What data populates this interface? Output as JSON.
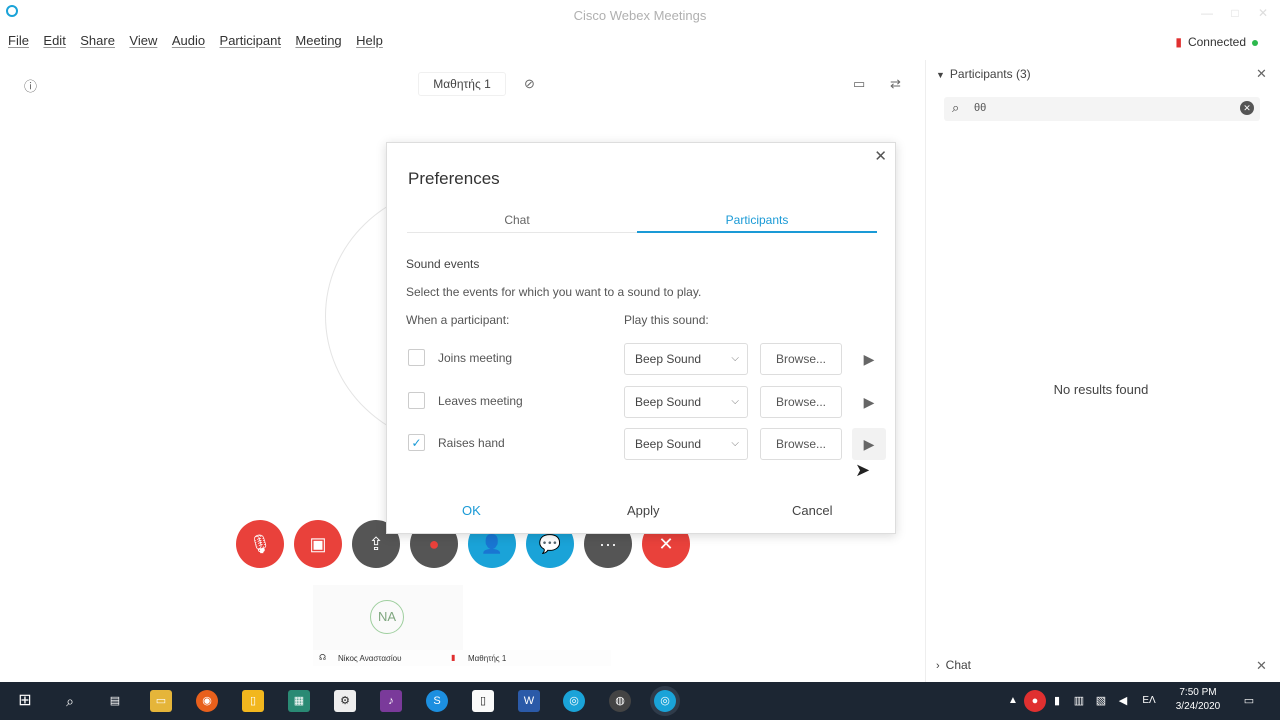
{
  "window": {
    "title": "Cisco Webex Meetings"
  },
  "menu": [
    "File",
    "Edit",
    "Share",
    "View",
    "Audio",
    "Participant",
    "Meeting",
    "Help"
  ],
  "status": {
    "label": "Connected",
    "color": "#2db84d"
  },
  "stage": {
    "presenter_name": "Μαθητής 1"
  },
  "participants_panel": {
    "header": "Participants (3)",
    "search_value": "θθ",
    "empty_message": "No results found"
  },
  "chat_panel": {
    "header": "Chat"
  },
  "thumbnail": {
    "initials": "NA",
    "left_name": "Νίκος Αναστασίου",
    "right_name": "Μαθητής 1"
  },
  "controls": {
    "mute": "#e9413b",
    "video": "#e9413b",
    "share": "#555555",
    "record": "#555555",
    "participants": "#1aa3d8",
    "chat": "#1aa3d8",
    "more": "#555555",
    "leave": "#e9413b"
  },
  "dialog": {
    "title": "Preferences",
    "tabs": [
      "Chat",
      "Participants"
    ],
    "active_tab": "Participants",
    "section_title": "Sound events",
    "description": "Select the events for which you want to a sound to play.",
    "col_left": "When a participant:",
    "col_right": "Play this sound:",
    "rows": [
      {
        "label": "Joins meeting",
        "checked": false,
        "sound": "Beep Sound",
        "browse": "Browse..."
      },
      {
        "label": "Leaves meeting",
        "checked": false,
        "sound": "Beep Sound",
        "browse": "Browse..."
      },
      {
        "label": "Raises hand",
        "checked": true,
        "sound": "Beep Sound",
        "browse": "Browse..."
      }
    ],
    "buttons": {
      "ok": "OK",
      "apply": "Apply",
      "cancel": "Cancel"
    },
    "accent": "#1a9ad6"
  },
  "taskbar": {
    "time": "7:50 PM",
    "date": "3/24/2020",
    "language": "ΕΛ"
  }
}
